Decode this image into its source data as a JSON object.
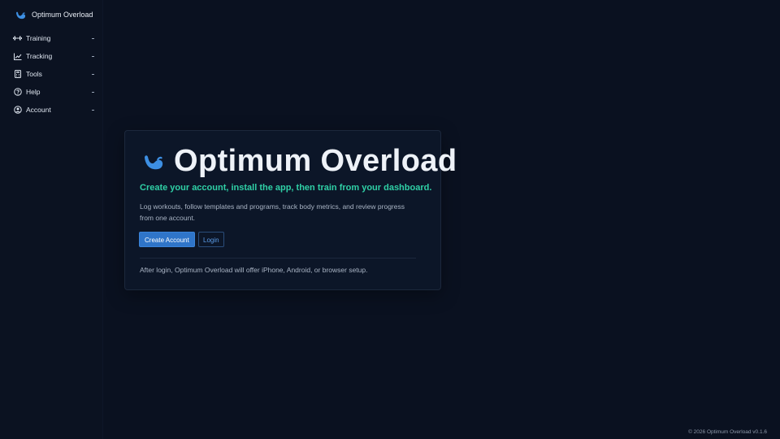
{
  "app": {
    "name": "Optimum Overload",
    "logo_icon": "flexed-arm-icon",
    "accent": "#2f75c9"
  },
  "sidebar": {
    "items": [
      {
        "label": "Training",
        "icon": "dumbbell-icon"
      },
      {
        "label": "Tracking",
        "icon": "chart-line-icon"
      },
      {
        "label": "Tools",
        "icon": "calculator-icon"
      },
      {
        "label": "Help",
        "icon": "question-circle-icon"
      },
      {
        "label": "Account",
        "icon": "user-circle-icon"
      }
    ]
  },
  "hero": {
    "title": "Optimum Overload",
    "tagline": "Create your account, install the app, then train from your dashboard.",
    "tagline_color": "#2fd0a6",
    "description": "Log workouts, follow templates and programs, track body metrics, and review progress from one account.",
    "create_label": "Create Account",
    "login_label": "Login",
    "note": "After login, Optimum Overload will offer iPhone, Android, or browser setup."
  },
  "footer": {
    "text": "© 2026 Optimum Overload v0.1.6"
  }
}
